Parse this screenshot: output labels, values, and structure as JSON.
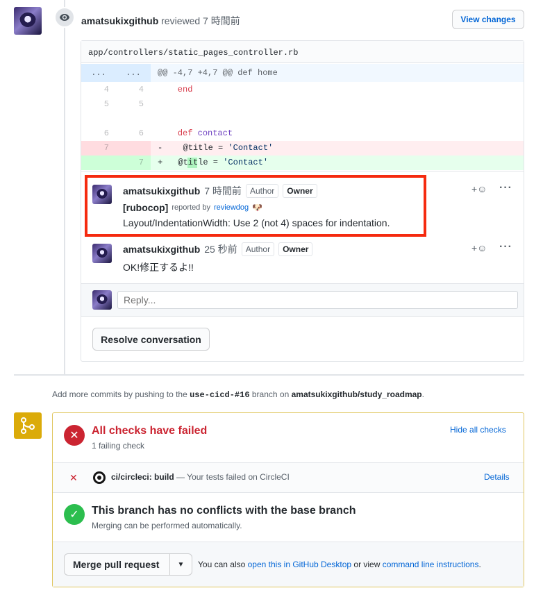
{
  "review": {
    "reviewer": "amatsukixgithub",
    "action": "reviewed 7 時間前",
    "view_changes": "View changes"
  },
  "file": {
    "path": "app/controllers/static_pages_controller.rb",
    "hunk_left": "...",
    "hunk_right": "...",
    "hunk_header": "@@ -4,7 +4,7 @@ def home",
    "lines": [
      {
        "old": "4",
        "new": "4",
        "sign": "",
        "code": "    end",
        "type": "ctx"
      },
      {
        "old": "5",
        "new": "5",
        "sign": "",
        "code": "",
        "type": "ctx"
      },
      {
        "old": "",
        "new": "",
        "sign": "",
        "code": "",
        "type": "ctx"
      },
      {
        "old": "6",
        "new": "6",
        "sign": "",
        "code": "    def contact",
        "type": "ctx"
      },
      {
        "old": "7",
        "new": "",
        "sign": "-",
        "code": "      @title = 'Contact'",
        "type": "del"
      },
      {
        "old": "",
        "new": "7",
        "sign": "+",
        "code": "    @title = 'Contact'",
        "type": "add"
      }
    ]
  },
  "comments": [
    {
      "author": "amatsukixgithub",
      "time": "7 時間前",
      "label_author": "Author",
      "label_owner": "Owner",
      "bot_tag": "[rubocop]",
      "reported_by": "reported by",
      "reporter": "reviewdog",
      "body": "Layout/IndentationWidth: Use 2 (not 4) spaces for indentation."
    },
    {
      "author": "amatsukixgithub",
      "time": "25 秒前",
      "label_author": "Author",
      "label_owner": "Owner",
      "body": "OK!修正するよ!!"
    }
  ],
  "reply": {
    "placeholder": "Reply..."
  },
  "resolve_label": "Resolve conversation",
  "push_hint": {
    "prefix": "Add more commits by pushing to the",
    "branch": "use-cicd-#16",
    "middle": "branch on",
    "repo": "amatsukixgithub/study_roadmap",
    "suffix": "."
  },
  "checks": {
    "title": "All checks have failed",
    "subtitle": "1 failing check",
    "hide_label": "Hide all checks",
    "check_name": "ci/circleci: build",
    "check_desc": "— Your tests failed on CircleCI",
    "details": "Details"
  },
  "conflicts": {
    "title": "This branch has no conflicts with the base branch",
    "subtitle": "Merging can be performed automatically."
  },
  "merge": {
    "button": "Merge pull request",
    "also": "You can also",
    "desktop_link": "open this in GitHub Desktop",
    "or_view": "or view",
    "cli_link": "command line instructions",
    "period": "."
  },
  "colors": {
    "danger": "#cb2431",
    "success": "#2cbe4e",
    "link": "#0366d6",
    "merge_icon_bg": "#dbab09",
    "highlight": "#f52a0f"
  }
}
